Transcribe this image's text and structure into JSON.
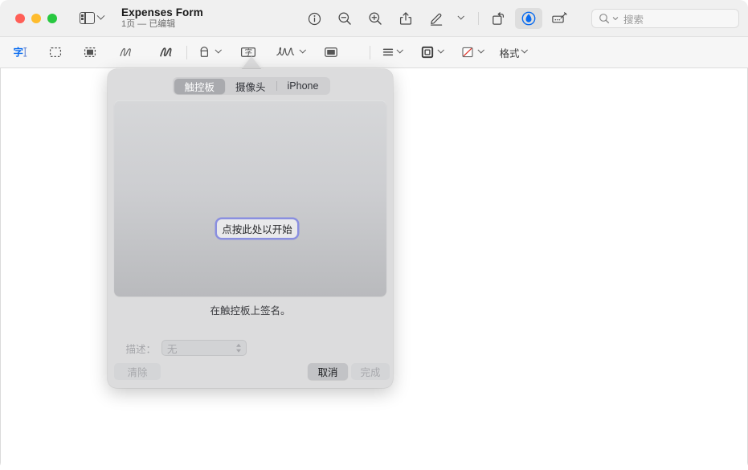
{
  "window": {
    "traffic_lights": [
      "close",
      "minimize",
      "maximize"
    ],
    "sidebar_toggle_label": "sidebar-toggle",
    "doc_title": "Expenses Form",
    "doc_subtitle": "1页 — 已编辑"
  },
  "toolbar": {
    "buttons": [
      {
        "name": "info-icon",
        "glyph": "info"
      },
      {
        "name": "zoom-out-icon",
        "glyph": "zoom-out"
      },
      {
        "name": "zoom-in-icon",
        "glyph": "zoom-in"
      },
      {
        "name": "share-icon",
        "glyph": "share"
      },
      {
        "name": "markup-pen-icon",
        "glyph": "pen"
      },
      {
        "name": "rotate-icon",
        "glyph": "rotate"
      },
      {
        "name": "markup-icon",
        "glyph": "markup"
      },
      {
        "name": "annotate-icon",
        "glyph": "annotate"
      }
    ],
    "search": {
      "placeholder": "搜索",
      "icon": "search-icon",
      "value": ""
    }
  },
  "markup_toolbar": {
    "tools": [
      {
        "name": "text-selection-tool",
        "selected": true
      },
      {
        "name": "rectangular-selection-tool",
        "selected": false
      },
      {
        "name": "instant-alpha-tool",
        "selected": false
      },
      {
        "name": "sketch-tool",
        "selected": false
      },
      {
        "name": "draw-tool",
        "selected": false
      },
      {
        "name": "shapes-tool",
        "selected": false
      },
      {
        "name": "text-tool",
        "selected": false
      },
      {
        "name": "signature-tool",
        "selected": false
      },
      {
        "name": "note-tool",
        "selected": false
      },
      {
        "name": "text-style-tool",
        "selected": false
      },
      {
        "name": "shape-style-tool",
        "selected": false
      },
      {
        "name": "border-color-tool",
        "selected": false
      }
    ],
    "format_label": "格式"
  },
  "signature_popover": {
    "tabs": [
      {
        "label": "触控板",
        "selected": true
      },
      {
        "label": "摄像头",
        "selected": false
      },
      {
        "label": "iPhone",
        "selected": false
      }
    ],
    "start_button_label": "点按此处以开始",
    "hint_text": "在触控板上签名。",
    "description": {
      "label": "描述：",
      "value": "无",
      "enabled": false
    },
    "buttons": {
      "clear": "清除",
      "cancel": "取消",
      "done": "完成"
    }
  },
  "colors": {
    "accent": "#0a6cf0",
    "focus_ring": "#8a8fe0",
    "titlebar_bg": "#f0f0f0",
    "popover_bg": "#dcdcdd",
    "segment_on": "#a9aaae"
  }
}
